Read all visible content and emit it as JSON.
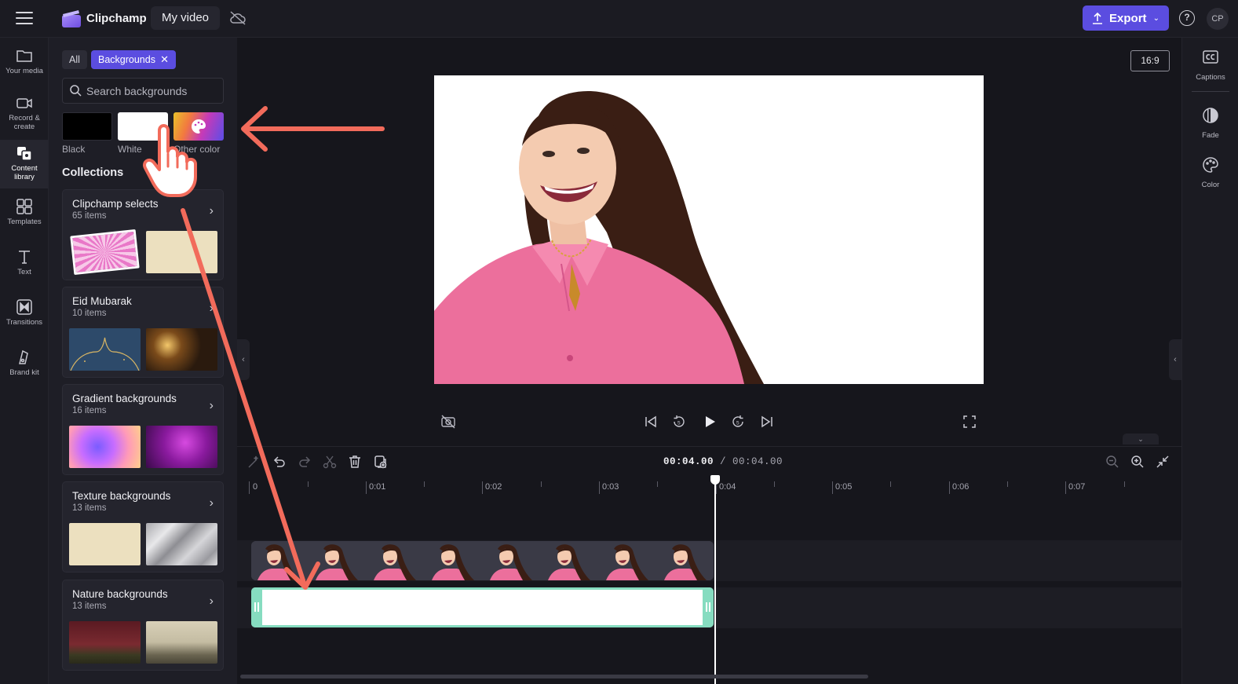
{
  "app": {
    "brand": "Clipchamp",
    "project_title": "My video"
  },
  "topbar": {
    "export_label": "Export",
    "help_glyph": "?",
    "avatar_initials": "CP",
    "export_color": "#5b4de0"
  },
  "leftnav": {
    "items": [
      {
        "label": "Your media",
        "icon": "folder-icon"
      },
      {
        "label": "Record & create",
        "icon": "camera-icon"
      },
      {
        "label": "Content library",
        "icon": "content-library-icon",
        "active": true
      },
      {
        "label": "Templates",
        "icon": "templates-icon"
      },
      {
        "label": "Text",
        "icon": "text-icon"
      },
      {
        "label": "Transitions",
        "icon": "transitions-icon"
      },
      {
        "label": "Brand kit",
        "icon": "brand-kit-icon"
      }
    ]
  },
  "panel": {
    "chips": {
      "all": "All",
      "active": "Backgrounds",
      "close": "✕"
    },
    "search": {
      "placeholder": "Search backgrounds"
    },
    "colors": [
      {
        "label": "Black",
        "hex": "#000000"
      },
      {
        "label": "White",
        "hex": "#ffffff"
      },
      {
        "label": "Other color",
        "hex": "gradient"
      }
    ],
    "collections_title": "Collections",
    "collections": [
      {
        "name": "Clipchamp selects",
        "count": "65 items"
      },
      {
        "name": "Eid Mubarak",
        "count": "10 items"
      },
      {
        "name": "Gradient backgrounds",
        "count": "16 items"
      },
      {
        "name": "Texture backgrounds",
        "count": "13 items"
      },
      {
        "name": "Nature backgrounds",
        "count": "13 items"
      }
    ]
  },
  "preview": {
    "aspect_ratio": "16:9",
    "background_color": "#ffffff"
  },
  "rightnav": {
    "items": [
      {
        "label": "Captions",
        "icon": "captions-icon"
      },
      {
        "label": "Fade",
        "icon": "fade-icon"
      },
      {
        "label": "Color",
        "icon": "color-palette-icon"
      }
    ]
  },
  "timeline": {
    "current_time": "00:04.00",
    "total_time": "/ 00:04.00",
    "ruler_labels": [
      "0",
      "0:01",
      "0:02",
      "0:03",
      "0:04",
      "0:05",
      "0:06",
      "0:07"
    ],
    "clip_accent": "#86dcc0"
  }
}
